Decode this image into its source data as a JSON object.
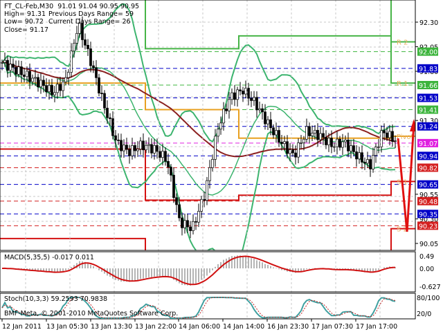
{
  "header": {
    "symbol_line": "FT_CL-Feb,M30  91.01 91.04 90.95 90.95",
    "high": "High= 91.31",
    "low": "Low= 90.72",
    "close": "Close= 91.17",
    "prev_range": "Previous Days Range= 59",
    "curr_range": "Current Days Range= 26"
  },
  "macd": {
    "label": "MACD(5,35,5) -0.017 0.011",
    "scale": [
      "0.49",
      "0.00",
      "-0.627"
    ]
  },
  "stoch": {
    "label": "Stoch(10,3,3) 59.2593 70.9838",
    "scale": [
      "80/100",
      "20/0"
    ]
  },
  "copyright": "BMF-Meta, © 2001-2010 MetaQuotes Software Corp.",
  "chart_data": {
    "type": "candlestick",
    "price_axis": [
      "92.30",
      "92.05",
      "91.80",
      "91.30",
      "90.55",
      "90.30",
      "90.05"
    ],
    "ylim": [
      90.0,
      92.52
    ],
    "time_labels": [
      "12 Jan 2011",
      "13 Jan 05:30",
      "13 Jan 13:30",
      "13 Jan 22:00",
      "14 Jan 06:00",
      "14 Jan 14:00",
      "16 Jan 23:30",
      "17 Jan 07:30",
      "17 Jan 17:00"
    ],
    "close_path": [
      91.89,
      91.82,
      91.75,
      91.68,
      91.58,
      91.7,
      92.28,
      91.9,
      91.47,
      91.08,
      90.98,
      91.05,
      91.01,
      90.9,
      90.27,
      90.2,
      90.56,
      91.22,
      91.54,
      91.61,
      91.47,
      91.26,
      91.08,
      90.94,
      91.19,
      91.15,
      91.05,
      91.08,
      90.94,
      90.84,
      91.19,
      91.1
    ],
    "levels": [
      {
        "label": "91.83",
        "color": "#0000c8",
        "style": "dash"
      },
      {
        "label": "91.53",
        "color": "#0000c8",
        "style": "dash"
      },
      {
        "label": "91.24",
        "color": "#0000c8",
        "style": "dash"
      },
      {
        "label": "90.94",
        "color": "#0000c8",
        "style": "dash"
      },
      {
        "label": "90.65",
        "color": "#0000c8",
        "style": "dash"
      },
      {
        "label": "90.35",
        "color": "#0000c8",
        "style": "dash"
      },
      {
        "label": "92.00",
        "color": "#3cb43c",
        "style": "dash"
      },
      {
        "label": "91.66",
        "color": "#3cb43c",
        "style": "dash"
      },
      {
        "label": "91.41",
        "color": "#3cb43c",
        "style": "dash"
      },
      {
        "label": "91.07",
        "color": "#e020e0",
        "style": "dash"
      },
      {
        "label": "90.82",
        "color": "#d42020",
        "style": "dash"
      },
      {
        "label": "90.48",
        "color": "#d42020",
        "style": "dash"
      },
      {
        "label": "90.23",
        "color": "#d42020",
        "style": "dash"
      }
    ],
    "pivots": [
      {
        "name": "R 2",
        "color": "#46b446",
        "steps": [
          92.9,
          92.03,
          92.16,
          92.1
        ]
      },
      {
        "name": "R 1",
        "color": "#46b446",
        "steps": [
          92.9,
          92.9,
          92.9,
          91.68
        ]
      },
      {
        "name": "Pivot",
        "color": "#e8a020",
        "steps": [
          91.68,
          91.41,
          91.12,
          91.14
        ]
      },
      {
        "name": "S 1",
        "color": "#d41010",
        "steps": [
          91.01,
          90.49,
          90.54,
          90.68
        ]
      },
      {
        "name": "S 2",
        "color": "#d41010",
        "steps": [
          90.1,
          89.8,
          89.8,
          90.2
        ]
      }
    ]
  }
}
